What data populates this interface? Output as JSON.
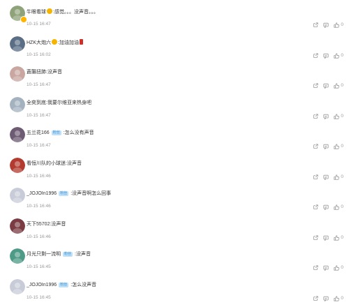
{
  "comments": [
    {
      "user": "牛眼看球",
      "emoji": "smile",
      "text": "感觉。。。没声音。。。",
      "time": "10-15 16:47",
      "likes": "0",
      "avatar": "#8fa37a",
      "verified": true
    },
    {
      "user": "HZK大炮六",
      "emoji": "smile",
      "text": "加油加油",
      "redpacket": true,
      "time": "10-15 16:02",
      "likes": "0",
      "avatar": "#5a6e86"
    },
    {
      "user": "蒼腸扭肺",
      "text": "没声音",
      "time": "10-15 16:47",
      "likes": "0",
      "avatar": "#c9a6a0"
    },
    {
      "user": "全奕到底",
      "text": "我要尔维亚来热身吧",
      "time": "10-15 16:47",
      "likes": "0",
      "avatar": "#a4b2bf"
    },
    {
      "user": "五兰花166",
      "badge": "粉丝",
      "text": "怎么没有声音",
      "time": "10-15 16:47",
      "likes": "0",
      "avatar": "#6d5a73"
    },
    {
      "user": "看恒川队的小球迷",
      "text": "没声音",
      "time": "10-15 16:46",
      "likes": "0",
      "avatar": "#b23a2e"
    },
    {
      "user": "_JOJOIn1996",
      "badge": "粉丝",
      "text": "没声音啊怎么回事",
      "time": "10-15 16:46",
      "likes": "0",
      "avatar": "#c8ccd8"
    },
    {
      "user": "天下55702",
      "text": "没声音",
      "time": "10-15 16:46",
      "likes": "0",
      "avatar": "#7a3b42"
    },
    {
      "user": "月光只剩一流明",
      "badge": "粉丝",
      "text": "没声音",
      "time": "10-15 16:45",
      "likes": "0",
      "avatar": "#4d9a86"
    },
    {
      "user": "_JOJOIn1996",
      "badge": "粉丝",
      "text": "怎么没声音",
      "time": "10-15 16:45",
      "likes": "0",
      "avatar": "#c8ccd8"
    }
  ],
  "icons": {
    "share": "share-icon",
    "comment": "comment-icon",
    "like": "like-icon"
  }
}
